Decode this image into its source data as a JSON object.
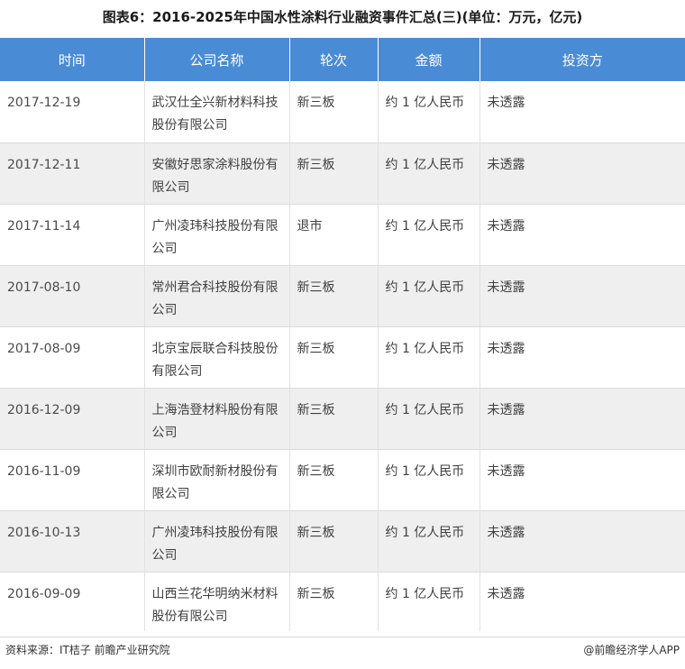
{
  "title": "图表6：2016-2025年中国水性涂料行业融资事件汇总(三)(单位：万元，亿元)",
  "headers": [
    "时间",
    "公司名称",
    "轮次",
    "金额",
    "投资方"
  ],
  "rows": [
    {
      "date": "2017-12-19",
      "company": "武汉仕全兴新材料科技股份有限公司",
      "round": "新三板",
      "amount": "约 1 亿人民币",
      "investor": "未透露"
    },
    {
      "date": "2017-12-11",
      "company": "安徽好思家涂料股份有限公司",
      "round": "新三板",
      "amount": "约 1 亿人民币",
      "investor": "未透露"
    },
    {
      "date": "2017-11-14",
      "company": "广州凌玮科技股份有限公司",
      "round": "退市",
      "amount": "约 1 亿人民币",
      "investor": "未透露"
    },
    {
      "date": "2017-08-10",
      "company": "常州君合科技股份有限公司",
      "round": "新三板",
      "amount": "约 1 亿人民币",
      "investor": "未透露"
    },
    {
      "date": "2017-08-09",
      "company": "北京宝辰联合科技股份有限公司",
      "round": "新三板",
      "amount": "约 1 亿人民币",
      "investor": "未透露"
    },
    {
      "date": "2016-12-09",
      "company": "上海浩登材料股份有限公司",
      "round": "新三板",
      "amount": "约 1 亿人民币",
      "investor": "未透露"
    },
    {
      "date": "2016-11-09",
      "company": "深圳市欧耐新材股份有限公司",
      "round": "新三板",
      "amount": "约 1 亿人民币",
      "investor": "未透露"
    },
    {
      "date": "2016-10-13",
      "company": "广州凌玮科技股份有限公司",
      "round": "新三板",
      "amount": "约 1 亿人民币",
      "investor": "未透露"
    },
    {
      "date": "2016-09-09",
      "company": "山西兰花华明纳米材料股份有限公司",
      "round": "新三板",
      "amount": "约 1 亿人民币",
      "investor": "未透露"
    }
  ],
  "footer": {
    "source": "资料来源：IT桔子 前瞻产业研究院",
    "brand": "@前瞻经济学人APP"
  }
}
